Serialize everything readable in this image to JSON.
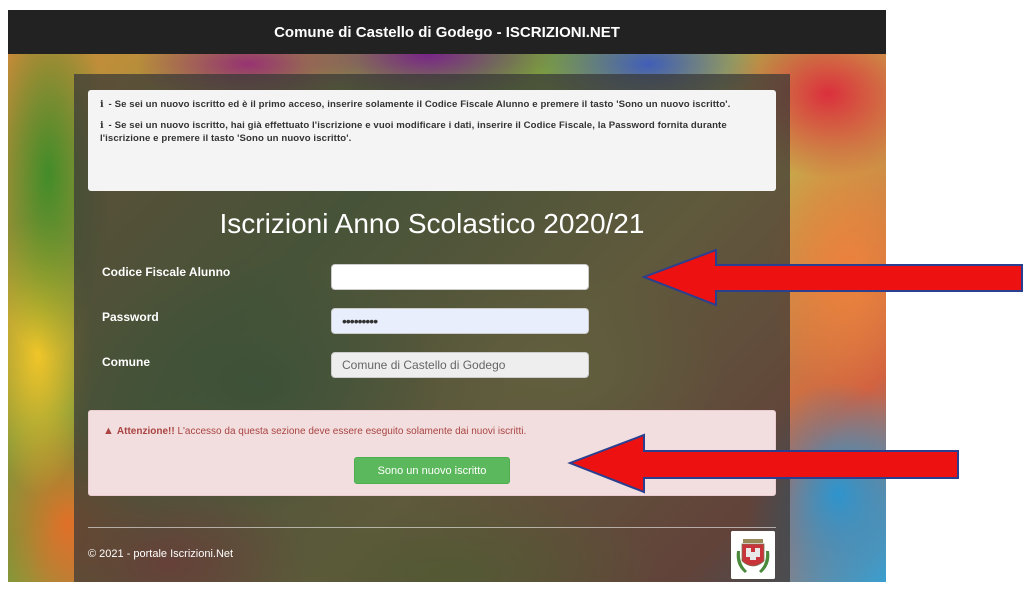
{
  "header": {
    "title": "Comune di Castello di Godego - ISCRIZIONI.NET"
  },
  "info": {
    "icon": "info-icon",
    "line1": "- Se sei un nuovo iscritto ed è il primo acceso, inserire solamente il Codice Fiscale Alunno e premere il tasto 'Sono un nuovo iscritto'.",
    "line2": "- Se sei un nuovo iscritto, hai già effettuato l'iscrizione e vuoi modificare i dati, inserire il Codice Fiscale, la Password fornita durante l'iscrizione e premere il tasto 'Sono un nuovo iscritto'."
  },
  "form": {
    "title": "Iscrizioni Anno Scolastico 2020/21",
    "codice_label": "Codice Fiscale Alunno",
    "codice_value": "",
    "password_label": "Password",
    "password_value": "•••••••••",
    "comune_label": "Comune",
    "comune_value": "Comune di Castello di Godego"
  },
  "alert": {
    "icon": "warning-icon",
    "strong": "Attenzione!!",
    "text": " L'accesso da questa sezione deve essere eseguito solamente dai nuovi iscritti.",
    "button": "Sono un nuovo iscritto"
  },
  "footer": {
    "text": "© 2021 - portale Iscrizioni.Net"
  },
  "colors": {
    "topbar": "#222222",
    "button": "#5cb85c",
    "alert_bg": "#f2dede",
    "alert_text": "#a94442",
    "arrow": "#ee1111"
  }
}
